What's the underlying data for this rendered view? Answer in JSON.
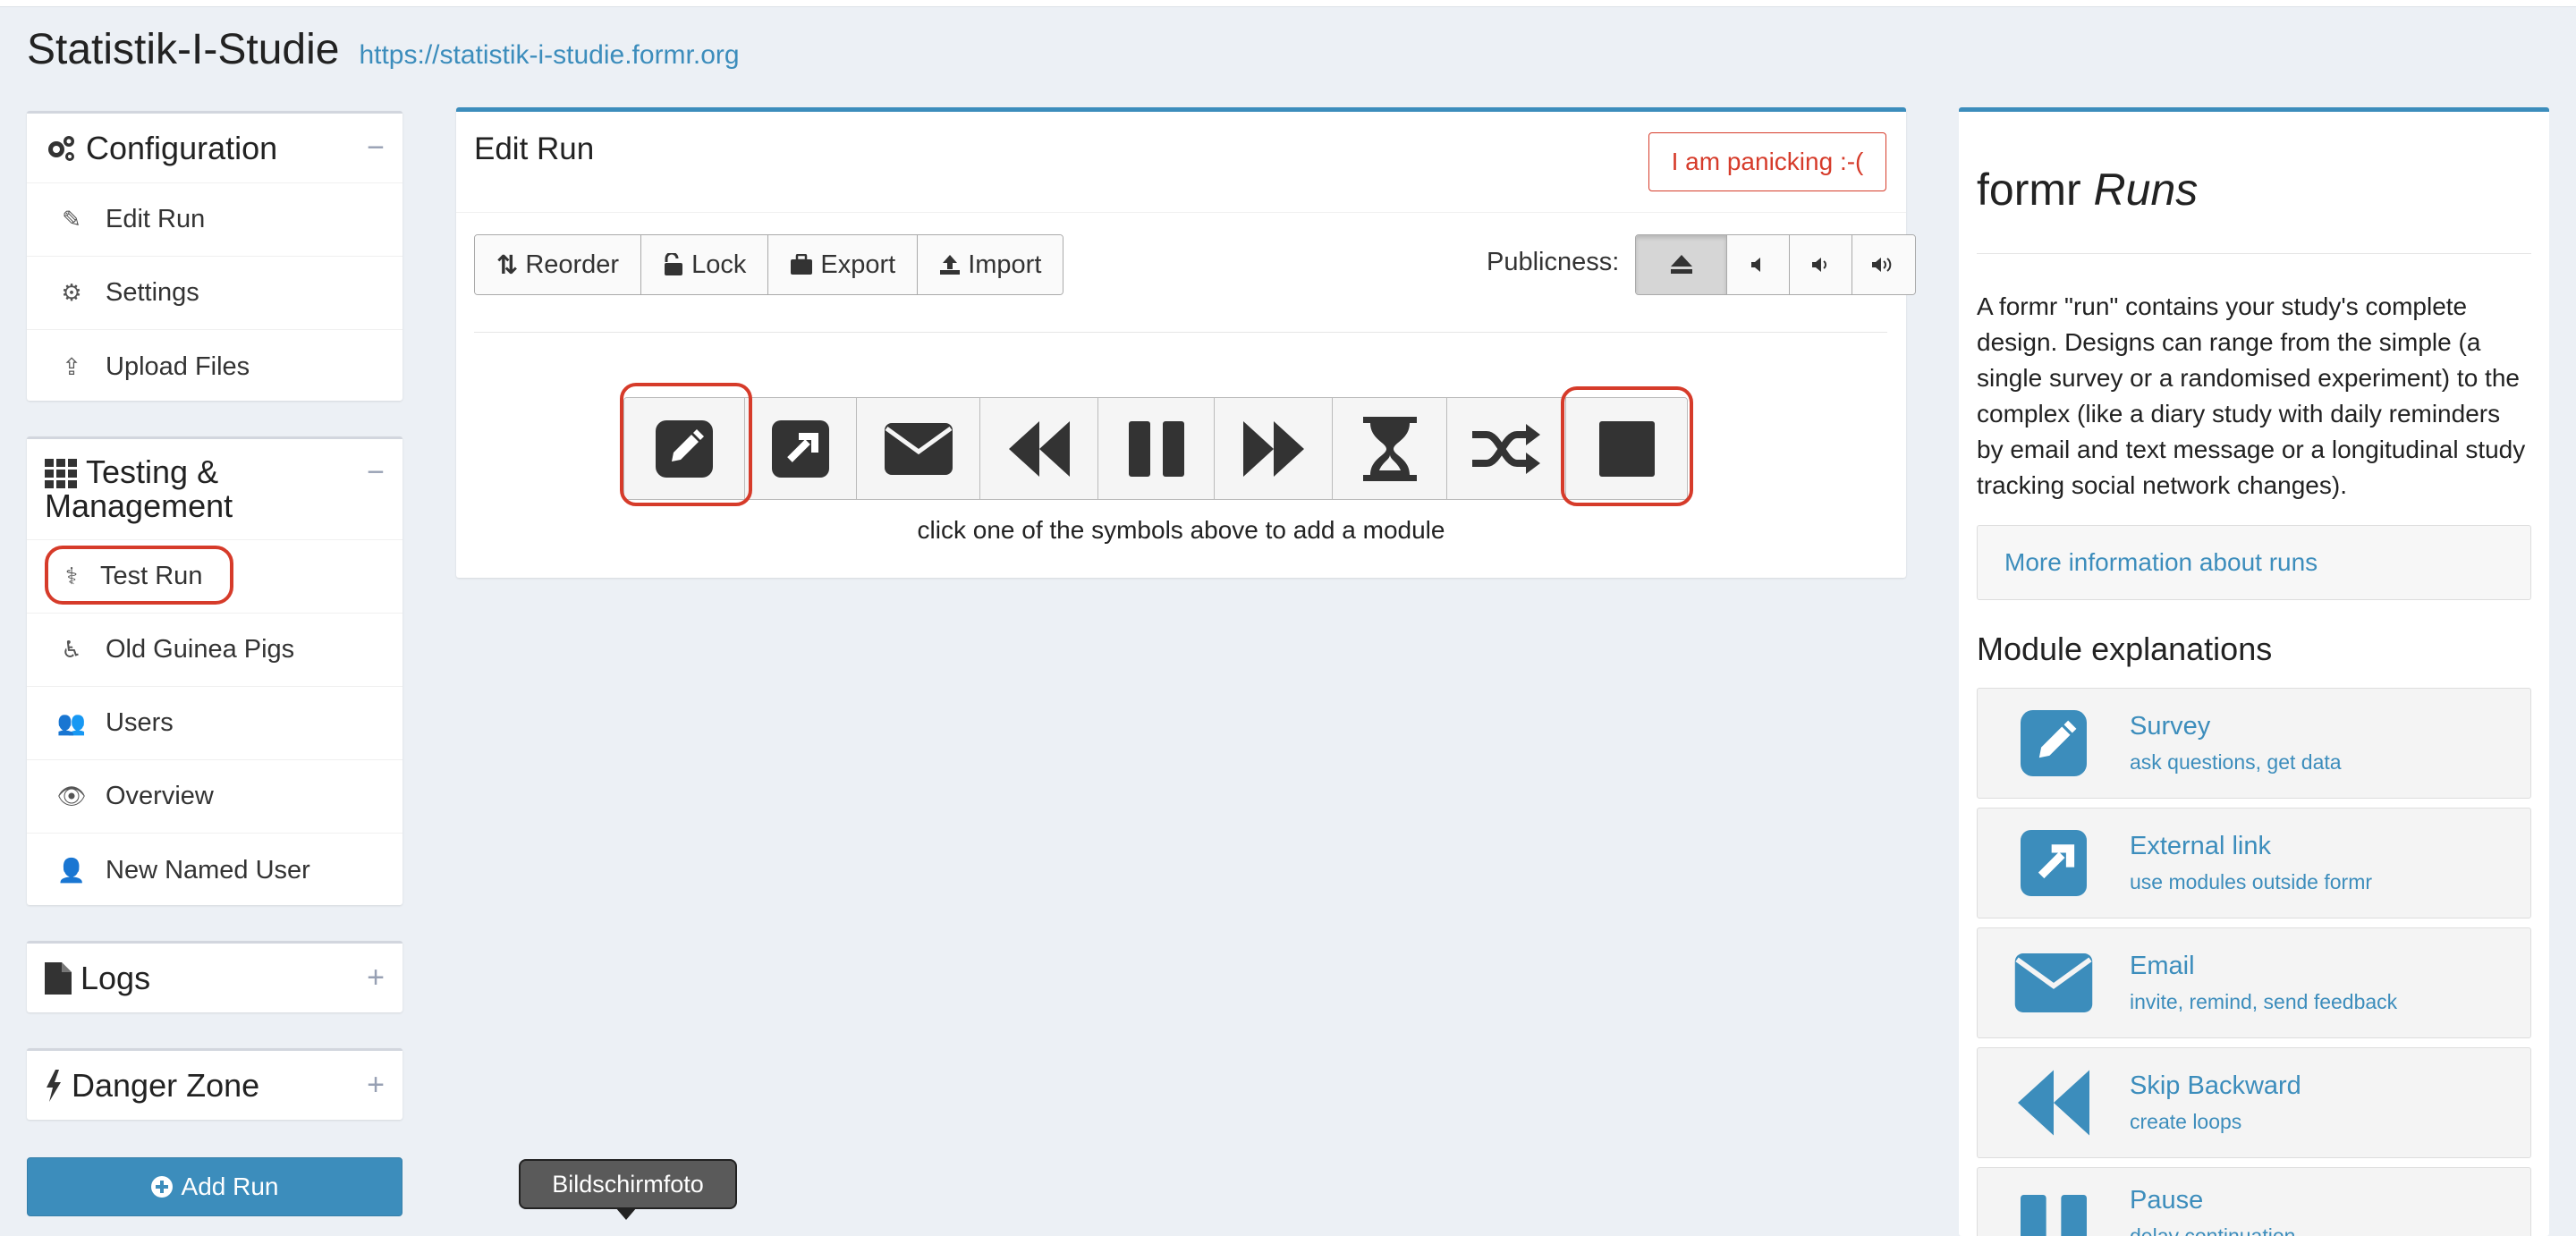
{
  "header": {
    "title": "Statistik-I-Studie",
    "url": "https://statistik-i-studie.formr.org"
  },
  "sidebar": {
    "configuration": {
      "title": "Configuration",
      "tool": "−",
      "items": [
        {
          "label": "Edit Run",
          "icon": "edit-icon"
        },
        {
          "label": "Settings",
          "icon": "gears-icon"
        },
        {
          "label": "Upload Files",
          "icon": "upload-icon"
        }
      ]
    },
    "testing": {
      "title_line1": "Testing &",
      "title_line2": "Management",
      "tool": "−",
      "items": [
        {
          "label": "Test Run",
          "icon": "stethoscope-icon"
        },
        {
          "label": "Old Guinea Pigs",
          "icon": "wheelchair-icon"
        },
        {
          "label": "Users",
          "icon": "users-icon"
        },
        {
          "label": "Overview",
          "icon": "eye-icon"
        },
        {
          "label": "New Named User",
          "icon": "user-icon"
        }
      ]
    },
    "logs": {
      "title": "Logs",
      "tool": "+"
    },
    "danger": {
      "title": "Danger Zone",
      "tool": "+"
    },
    "add_run": "Add Run"
  },
  "main": {
    "title": "Edit Run",
    "panic": "I am panicking :-(",
    "toolbar": {
      "reorder": "Reorder",
      "lock": "Lock",
      "export": "Export",
      "import": "Import"
    },
    "publicness_label": "Publicness:",
    "modules": [
      "survey-icon",
      "external-link-icon",
      "email-icon",
      "skip-backward-icon",
      "pause-icon",
      "skip-forward-icon",
      "wait-icon",
      "shuffle-icon",
      "stop-icon"
    ],
    "hint": "click one of the symbols above to add a module"
  },
  "info": {
    "title_plain": "formr ",
    "title_italic": "Runs",
    "description": "A formr \"run\" contains your study's complete design. Designs can range from the simple (a single survey or a randomised experiment) to the complex (like a diary study with daily reminders by email and text message or a longitudinal study tracking social network changes).",
    "more_link": "More information about runs",
    "modules_heading": "Module explanations",
    "module_cards": [
      {
        "name": "Survey",
        "desc": "ask questions, get data"
      },
      {
        "name": "External link",
        "desc": "use modules outside formr"
      },
      {
        "name": "Email",
        "desc": "invite, remind, send feedback"
      },
      {
        "name": "Skip Backward",
        "desc": "create loops"
      },
      {
        "name": "Pause",
        "desc": "delay continuation"
      }
    ]
  },
  "tooltip": "Bildschirmfoto",
  "colors": {
    "accent": "#3c8dbc",
    "highlight_ring": "#d63b2a",
    "panic": "#d63b2a"
  }
}
